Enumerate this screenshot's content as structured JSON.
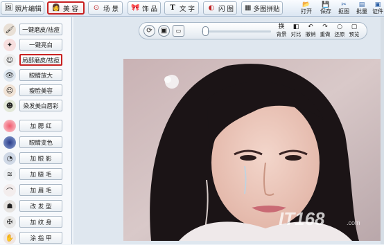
{
  "header": {
    "tabs": [
      {
        "label": "照片编辑",
        "icon": "photo-icon"
      },
      {
        "label": "美 容",
        "icon": "face-icon"
      },
      {
        "label": "场 景",
        "icon": "scene-icon"
      },
      {
        "label": "饰 品",
        "icon": "bow-icon"
      },
      {
        "label": "文 字",
        "icon": "text-icon"
      },
      {
        "label": "闪 图",
        "icon": "flash-icon"
      },
      {
        "label": "多图拼贴",
        "icon": "collage-icon"
      }
    ],
    "tools": [
      {
        "label": "打开",
        "icon": "open-icon"
      },
      {
        "label": "保存",
        "icon": "save-icon"
      },
      {
        "label": "抠图",
        "icon": "cutout-icon"
      },
      {
        "label": "批量",
        "icon": "batch-icon"
      },
      {
        "label": "证件",
        "icon": "id-icon"
      }
    ]
  },
  "sidebar": {
    "items": [
      {
        "label": "一键磨皮/祛痘",
        "icon": "brush-icon"
      },
      {
        "label": "一键亮白",
        "icon": "sparkle-icon"
      },
      {
        "label": "局部磨皮/祛痘",
        "icon": "face-icon"
      },
      {
        "label": "眼睛放大",
        "icon": "eye-icon"
      },
      {
        "label": "瘦脸美容",
        "icon": "face-icon"
      },
      {
        "label": "染发美白唇彩",
        "icon": "hair-icon"
      },
      {
        "label": "加 腮 红",
        "icon": "blush-icon"
      },
      {
        "label": "眼睛变色",
        "icon": "eye-color-icon"
      },
      {
        "label": "加 眼 影",
        "icon": "eyeshadow-icon"
      },
      {
        "label": "加 睫 毛",
        "icon": "eyelash-icon"
      },
      {
        "label": "加 眉 毛",
        "icon": "eyebrow-icon"
      },
      {
        "label": "改 发 型",
        "icon": "hairstyle-icon"
      },
      {
        "label": "加 纹 身",
        "icon": "tattoo-icon"
      },
      {
        "label": "涂 指 甲",
        "icon": "nail-icon"
      }
    ]
  },
  "photo_toolbar": {
    "actions": [
      {
        "label": "背景",
        "icon": "background-icon"
      },
      {
        "label": "对比",
        "icon": "compare-icon"
      },
      {
        "label": "撤销",
        "icon": "undo-icon"
      },
      {
        "label": "重做",
        "icon": "redo-icon"
      },
      {
        "label": "还原",
        "icon": "restore-icon"
      },
      {
        "label": "预览",
        "icon": "preview-icon"
      }
    ],
    "zoom_level": 0.05
  },
  "watermark": {
    "text": "IT168",
    "domain": ".com"
  },
  "colors": {
    "active_border": "#c82020"
  }
}
